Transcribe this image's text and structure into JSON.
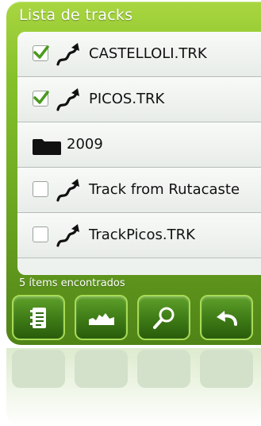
{
  "header": {
    "title": "Lista de tracks"
  },
  "items": [
    {
      "type": "track",
      "label": "CASTELLOLI.TRK",
      "checked": true
    },
    {
      "type": "track",
      "label": "PICOS.TRK",
      "checked": true
    },
    {
      "type": "folder",
      "label": "2009"
    },
    {
      "type": "track",
      "label": "Track from Rutacaste",
      "checked": false
    },
    {
      "type": "track",
      "label": "TrackPicos.TRK",
      "checked": false
    }
  ],
  "status": {
    "text": "5 ítems encontrados"
  },
  "toolbar": {
    "buttons": [
      {
        "icon": "list-icon"
      },
      {
        "icon": "profile-chart-icon"
      },
      {
        "icon": "search-icon"
      },
      {
        "icon": "back-arrow-icon"
      }
    ]
  },
  "colors": {
    "accent": "#7bb82a",
    "check": "#4a9a1e"
  }
}
